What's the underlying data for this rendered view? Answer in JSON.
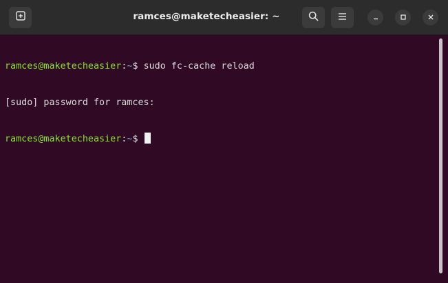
{
  "window": {
    "title": "ramces@maketecheasier: ~"
  },
  "terminal": {
    "lines": [
      {
        "user_host": "ramces@maketecheasier",
        "colon": ":",
        "path": "~",
        "symbol": "$ ",
        "command": "sudo fc-cache reload"
      },
      {
        "text": "[sudo] password for ramces:"
      },
      {
        "user_host": "ramces@maketecheasier",
        "colon": ":",
        "path": "~",
        "symbol": "$ "
      }
    ]
  },
  "colors": {
    "background": "#300a24",
    "prompt_user": "#8ae234",
    "prompt_path": "#729fcf",
    "text": "#dcdcdc",
    "titlebar": "#2c2c2c"
  },
  "icons": {
    "new_tab": "new-tab-icon",
    "search": "search-icon",
    "menu": "hamburger-menu-icon",
    "minimize": "minimize-icon",
    "maximize": "maximize-icon",
    "close": "close-icon"
  }
}
